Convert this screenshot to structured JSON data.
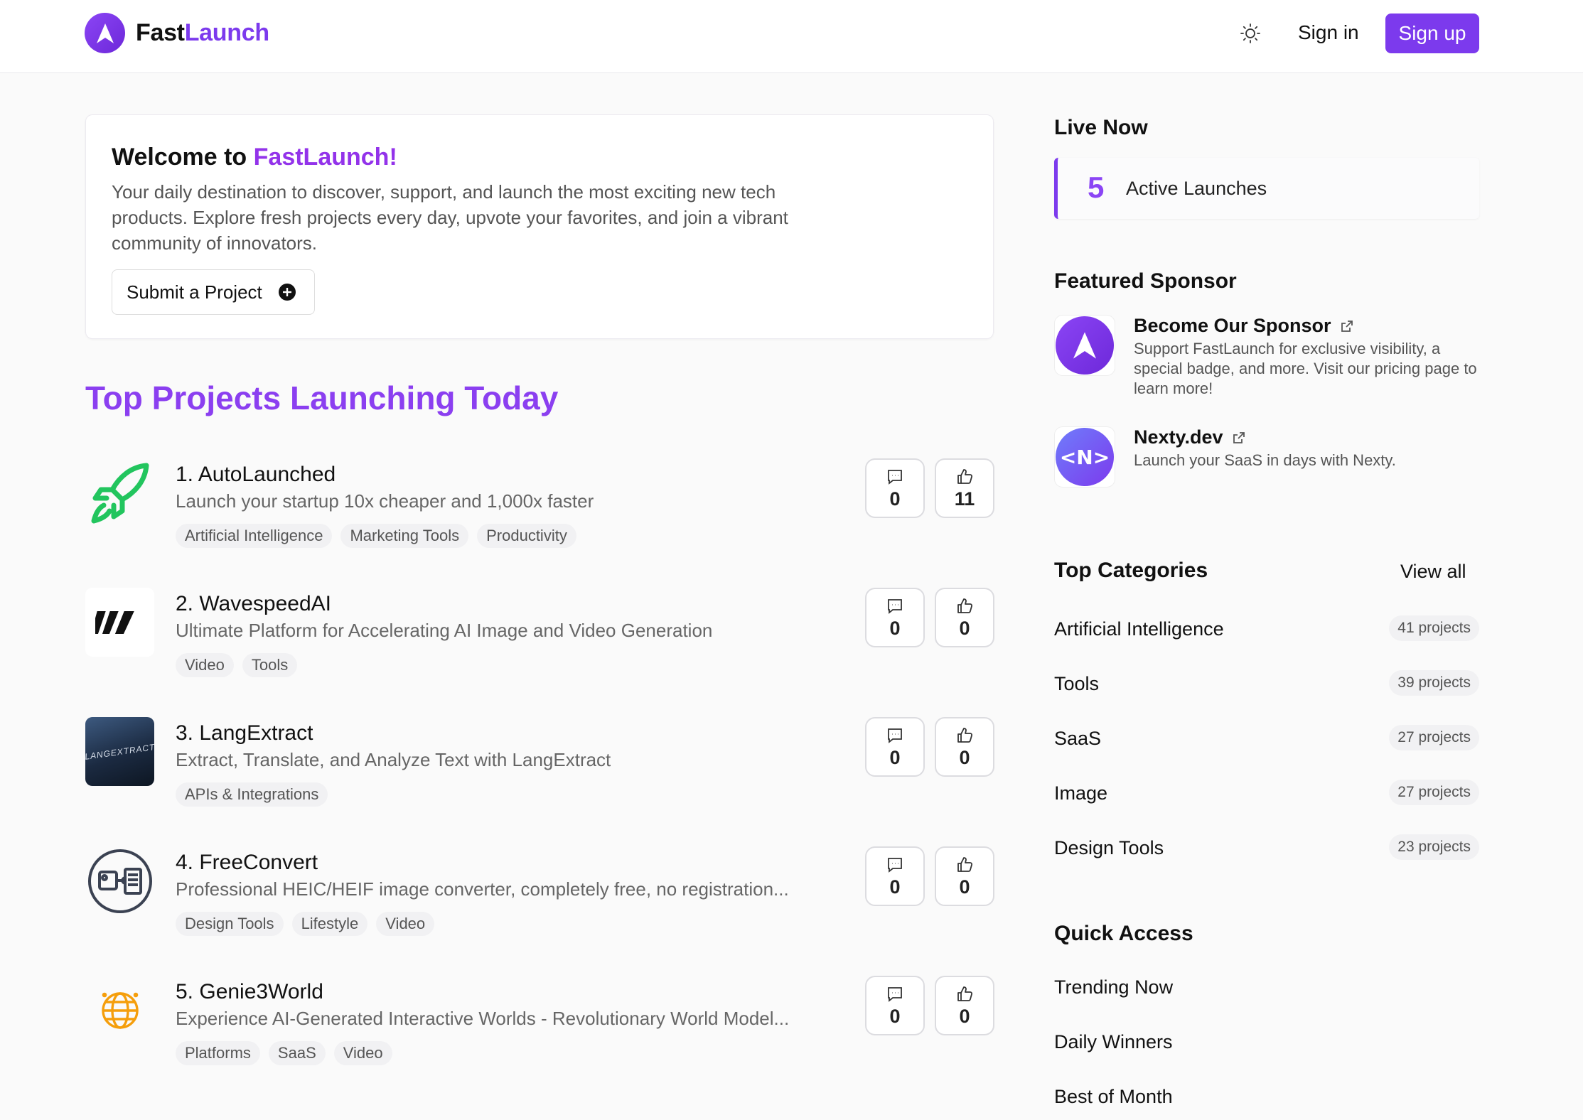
{
  "header": {
    "brand_part1": "Fast",
    "brand_part2": "Launch",
    "signin_label": "Sign in",
    "signup_label": "Sign up",
    "theme_icon": "sun-icon"
  },
  "welcome": {
    "title_prefix": "Welcome to ",
    "title_accent": "FastLaunch!",
    "description": "Your daily destination to discover, support, and launch the most exciting new tech products. Explore fresh projects every day, upvote your favorites, and join a vibrant community of innovators.",
    "submit_label": "Submit a Project"
  },
  "main": {
    "section_title": "Top Projects Launching Today"
  },
  "projects": [
    {
      "name": "1. AutoLaunched",
      "description": "Launch your startup 10x cheaper and 1,000x faster",
      "tags": [
        "Artificial Intelligence",
        "Marketing Tools",
        "Productivity"
      ],
      "comments": "0",
      "upvotes": "11",
      "icon": "rocket-icon"
    },
    {
      "name": "2. WavespeedAI",
      "description": "Ultimate Platform for Accelerating AI Image and Video Generation",
      "tags": [
        "Video",
        "Tools"
      ],
      "comments": "0",
      "upvotes": "0",
      "icon": "wavespeed-logo"
    },
    {
      "name": "3. LangExtract",
      "description": "Extract, Translate, and Analyze Text with LangExtract",
      "tags": [
        "APIs & Integrations"
      ],
      "comments": "0",
      "upvotes": "0",
      "icon": "langextract-logo",
      "logo_text": "LANGEXTRACT"
    },
    {
      "name": "4. FreeConvert",
      "description": "Professional HEIC/HEIF image converter, completely free, no registration...",
      "tags": [
        "Design Tools",
        "Lifestyle",
        "Video"
      ],
      "comments": "0",
      "upvotes": "0",
      "icon": "convert-icon"
    },
    {
      "name": "5. Genie3World",
      "description": "Experience AI-Generated Interactive Worlds - Revolutionary World Model...",
      "tags": [
        "Platforms",
        "SaaS",
        "Video"
      ],
      "comments": "0",
      "upvotes": "0",
      "icon": "globe-icon"
    }
  ],
  "sidebar": {
    "live_now": {
      "title": "Live Now",
      "count": "5",
      "label": "Active Launches"
    },
    "featured": {
      "title": "Featured Sponsor",
      "sponsors": [
        {
          "name": "Become Our Sponsor",
          "description": "Support FastLaunch for exclusive visibility, a special badge, and more. Visit our pricing page to learn more!",
          "icon": "fastlaunch-logo"
        },
        {
          "name": "Nexty.dev",
          "description": "Launch your SaaS in days with Nexty.",
          "icon": "nexty-logo",
          "logo_text": "<N>"
        }
      ]
    },
    "categories": {
      "title": "Top Categories",
      "view_all": "View all",
      "items": [
        {
          "name": "Artificial Intelligence",
          "count": "41 projects"
        },
        {
          "name": "Tools",
          "count": "39 projects"
        },
        {
          "name": "SaaS",
          "count": "27 projects"
        },
        {
          "name": "Image",
          "count": "27 projects"
        },
        {
          "name": "Design Tools",
          "count": "23 projects"
        }
      ]
    },
    "quick_access": {
      "title": "Quick Access",
      "items": [
        "Trending Now",
        "Daily Winners",
        "Best of Month"
      ]
    }
  },
  "colors": {
    "accent": "#7c3aed",
    "accent_light": "#9333ea",
    "rocket_green": "#22c55e",
    "globe_orange": "#f59e0b"
  }
}
